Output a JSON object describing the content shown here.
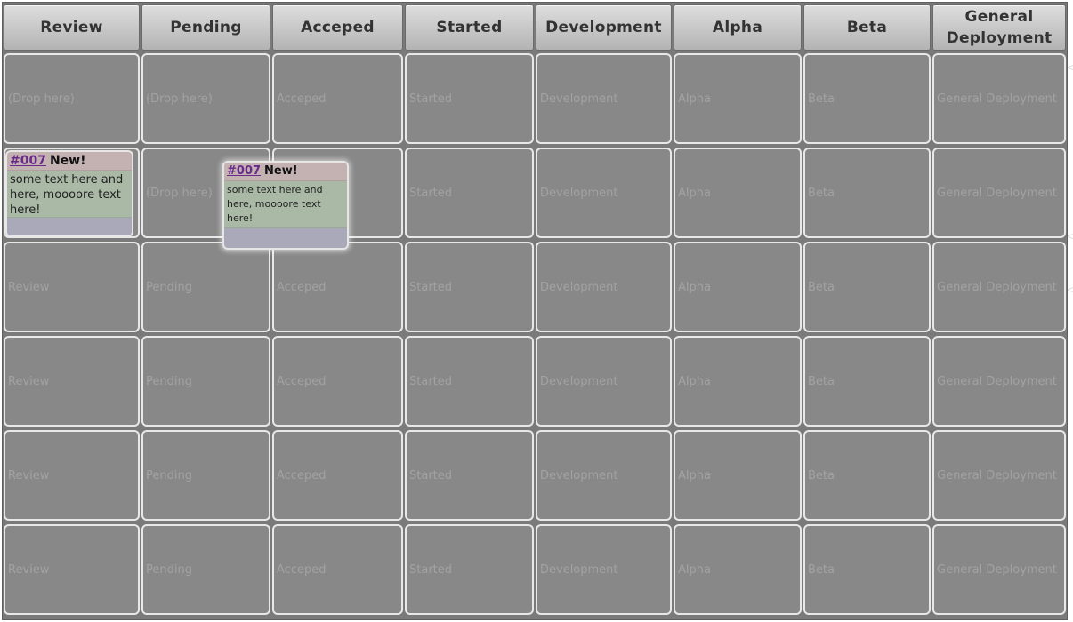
{
  "columns": [
    {
      "title": "Review"
    },
    {
      "title": "Pending"
    },
    {
      "title": "Acceped"
    },
    {
      "title": "Started"
    },
    {
      "title": "Development"
    },
    {
      "title": "Alpha"
    },
    {
      "title": "Beta"
    },
    {
      "title": "General Deployment"
    }
  ],
  "drop_label": "(Drop here)",
  "rows": [
    [
      "(Drop here)",
      "(Drop here)",
      "Acceped",
      "Started",
      "Development",
      "Alpha",
      "Beta",
      "General Deployment"
    ],
    [
      "",
      "(Drop here)",
      "Acceped",
      "Started",
      "Development",
      "Alpha",
      "Beta",
      "General Deployment"
    ],
    [
      "Review",
      "Pending",
      "Acceped",
      "Started",
      "Development",
      "Alpha",
      "Beta",
      "General Deployment"
    ],
    [
      "Review",
      "Pending",
      "Acceped",
      "Started",
      "Development",
      "Alpha",
      "Beta",
      "General Deployment"
    ],
    [
      "Review",
      "Pending",
      "Acceped",
      "Started",
      "Development",
      "Alpha",
      "Beta",
      "General Deployment"
    ],
    [
      "Review",
      "Pending",
      "Acceped",
      "Started",
      "Development",
      "Alpha",
      "Beta",
      "General Deployment"
    ]
  ],
  "cards": [
    {
      "id": "#007",
      "badge": "New!",
      "text": "some text here and here, moooore text here!"
    },
    {
      "id": "#007",
      "badge": "New!",
      "text": "some text here and here, moooore text here!"
    }
  ]
}
